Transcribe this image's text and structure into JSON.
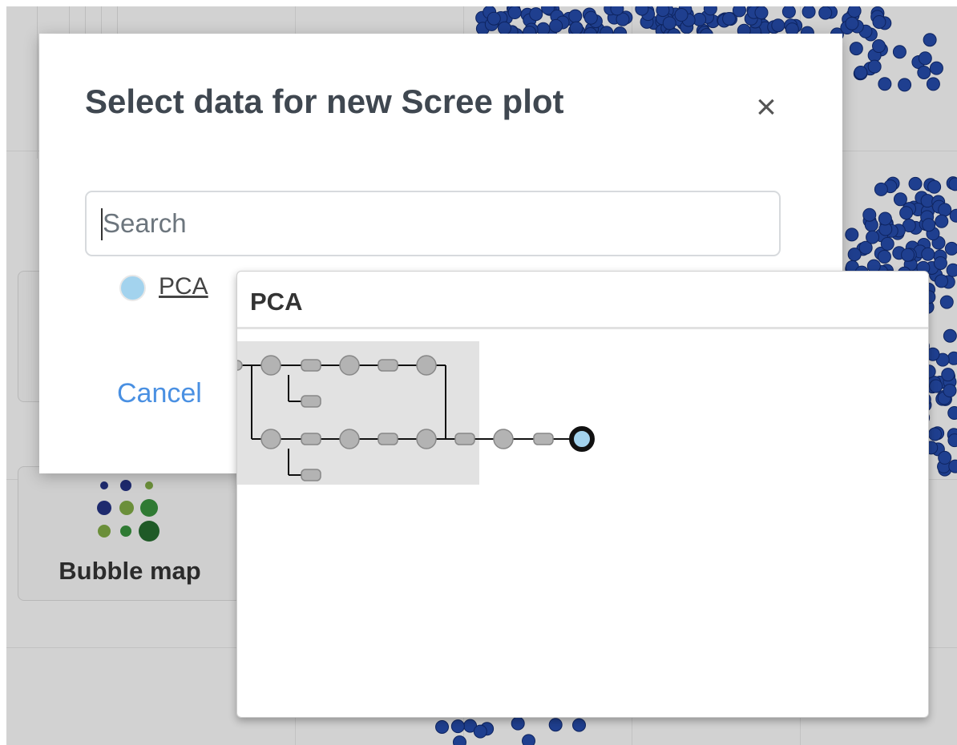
{
  "modal": {
    "title": "Select data for new Scree plot",
    "close_label": "×",
    "search_placeholder": "Search",
    "search_value": "",
    "cancel_label": "Cancel"
  },
  "results": [
    {
      "label": "PCA",
      "dot_color": "#a3d3ee"
    }
  ],
  "popover": {
    "title": "PCA"
  },
  "background": {
    "card_label": "Bubble map",
    "dot_color": "#1f3f8f"
  },
  "colors": {
    "accent": "#4a90e2",
    "title_text": "#3f4750",
    "pipeline_node": "#b3b3b3",
    "pipeline_target": "#a3d3ee"
  }
}
